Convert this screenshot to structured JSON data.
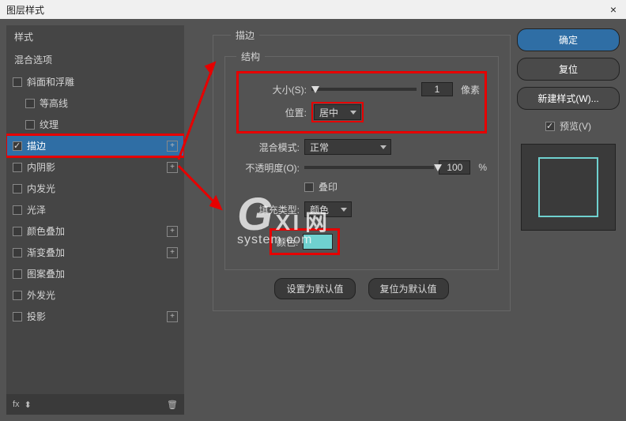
{
  "window": {
    "title": "图层样式",
    "close": "×"
  },
  "sidebar": {
    "header": "样式",
    "blend_options": "混合选项",
    "items": [
      {
        "label": "斜面和浮雕",
        "checked": false,
        "has_add": false,
        "indent": false
      },
      {
        "label": "等高线",
        "checked": false,
        "has_add": false,
        "indent": true
      },
      {
        "label": "纹理",
        "checked": false,
        "has_add": false,
        "indent": true
      },
      {
        "label": "描边",
        "checked": true,
        "has_add": true,
        "indent": false,
        "selected": true
      },
      {
        "label": "内阴影",
        "checked": false,
        "has_add": true,
        "indent": false
      },
      {
        "label": "内发光",
        "checked": false,
        "has_add": false,
        "indent": false
      },
      {
        "label": "光泽",
        "checked": false,
        "has_add": false,
        "indent": false
      },
      {
        "label": "颜色叠加",
        "checked": false,
        "has_add": true,
        "indent": false
      },
      {
        "label": "渐变叠加",
        "checked": false,
        "has_add": true,
        "indent": false
      },
      {
        "label": "图案叠加",
        "checked": false,
        "has_add": false,
        "indent": false
      },
      {
        "label": "外发光",
        "checked": false,
        "has_add": false,
        "indent": false
      },
      {
        "label": "投影",
        "checked": false,
        "has_add": true,
        "indent": false
      }
    ],
    "footer_fx": "fx"
  },
  "panel": {
    "outer_title": "描边",
    "structure_title": "结构",
    "size_label": "大小(S):",
    "size_value": "1",
    "size_unit": "像素",
    "position_label": "位置:",
    "position_value": "居中",
    "blend_label": "混合模式:",
    "blend_value": "正常",
    "opacity_label": "不透明度(O):",
    "opacity_value": "100",
    "opacity_unit": "%",
    "overprint_label": "叠印",
    "fill_type_label": "填充类型:",
    "fill_type_value": "颜色",
    "color_label": "颜色:",
    "set_default": "设置为默认值",
    "reset_default": "复位为默认值"
  },
  "right": {
    "ok": "确定",
    "cancel": "复位",
    "new_style": "新建样式(W)...",
    "preview": "预览(V)"
  },
  "watermark": {
    "brand": "G",
    "x": "X",
    "cn": "I 网",
    "sub": "system.com"
  }
}
